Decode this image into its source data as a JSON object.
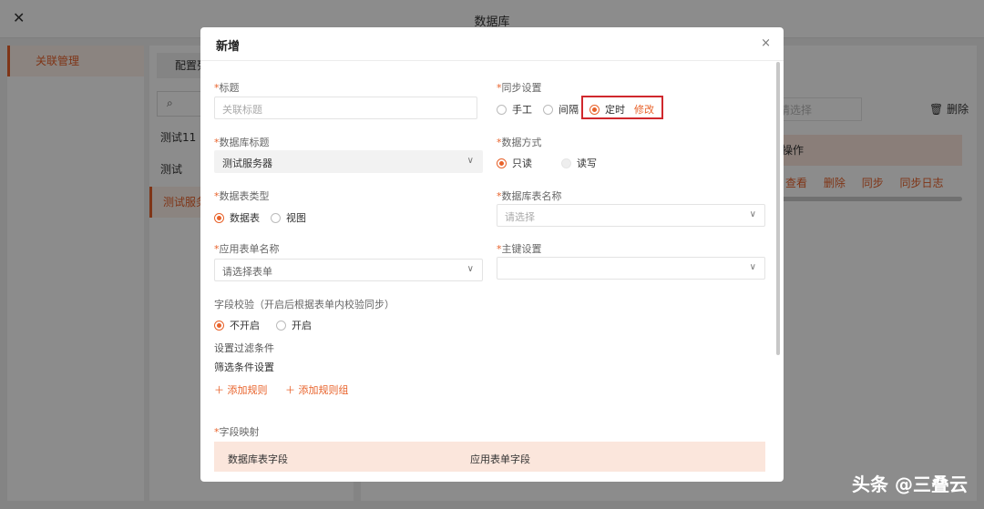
{
  "app": {
    "title": "数据库",
    "close_glyph": "✕"
  },
  "left_nav": {
    "items": [
      {
        "label": "关联管理"
      }
    ]
  },
  "middle": {
    "tab_label": "配置列",
    "search_icon": "search-icon",
    "items": [
      {
        "label": "测试11"
      },
      {
        "label": "测试"
      },
      {
        "label": "测试服务"
      }
    ]
  },
  "main": {
    "select_placeholder": "请选择",
    "delete_label": "删除",
    "table_header": "操作",
    "ops": [
      "查看",
      "删除",
      "同步",
      "同步日志"
    ]
  },
  "modal": {
    "title": "新增",
    "close_glyph": "×",
    "fields": {
      "title": {
        "label": "标题",
        "placeholder": "关联标题"
      },
      "sync": {
        "label": "同步设置",
        "options": [
          "手工",
          "间隔",
          "定时"
        ],
        "selected": "定时",
        "modify_label": "修改"
      },
      "db_title": {
        "label": "数据库标题",
        "value": "测试服务器"
      },
      "data_mode": {
        "label": "数据方式",
        "options": [
          "只读",
          "读写"
        ],
        "selected": "只读"
      },
      "table_type": {
        "label": "数据表类型",
        "options": [
          "数据表",
          "视图"
        ],
        "selected": "数据表"
      },
      "db_table_name": {
        "label": "数据库表名称",
        "placeholder": "请选择"
      },
      "app_form_name": {
        "label": "应用表单名称",
        "placeholder": "请选择表单"
      },
      "primary_key": {
        "label": "主键设置",
        "value": ""
      },
      "field_check": {
        "label": "字段校验（开启后根据表单内校验同步）",
        "options": [
          "不开启",
          "开启"
        ],
        "selected": "不开启"
      },
      "filter": {
        "label": "设置过滤条件",
        "sub_label": "筛选条件设置"
      },
      "add_rule": "添加规则",
      "add_rule_group": "添加规则组",
      "field_map": {
        "label": "字段映射",
        "col1": "数据库表字段",
        "col2": "应用表单字段"
      }
    }
  },
  "watermark": "头条 @三叠云",
  "colors": {
    "accent": "#e8622a",
    "highlight": "#d0282d"
  }
}
